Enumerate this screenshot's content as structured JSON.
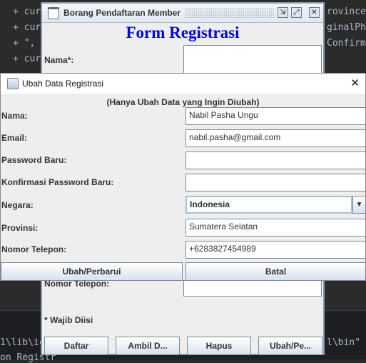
{
  "editor": {
    "lines_left": [
      "+ cur",
      "+ cur",
      "+ \",",
      "+ cur"
    ],
    "lines_right": [
      "rovince",
      "ginalPho",
      "ConfirmP"
    ],
    "terminal_left": "1\\lib\\ic",
    "terminal_right": "l\\bin\" -",
    "terminal_bottom": "on Registr"
  },
  "main_window": {
    "title": "Borang Pendaftaran Member",
    "heading": "Form Registrasi",
    "nama_label": "Nama*:",
    "phone_label": "Nomor Telepon:",
    "required_note": "* Wajib Diisi",
    "buttons": [
      "Daftar",
      "Ambil D...",
      "Hapus",
      "Ubah/Pe..."
    ],
    "controls": {
      "minimize": "⇲",
      "maximize": "⤢",
      "close": "✕"
    }
  },
  "dialog": {
    "title": "Ubah Data Registrasi",
    "close": "✕",
    "subtitle": "(Hanya Ubah Data yang Ingin Diubah)",
    "fields": [
      {
        "label": "Nama:",
        "value": "Nabil Pasha Ungu"
      },
      {
        "label": "Email:",
        "value": "nabil.pasha@gmail.com"
      },
      {
        "label": "Password Baru:",
        "value": ""
      },
      {
        "label": "Konfirmasi Password Baru:",
        "value": ""
      },
      {
        "label": "Negara:",
        "value": "Indonesia"
      },
      {
        "label": "Provinsi:",
        "value": "Sumatera Selatan"
      },
      {
        "label": "Nomor Telepon:",
        "value": "+6283827454989"
      }
    ],
    "update_button": "Ubah/Perbarui",
    "cancel_button": "Batal"
  }
}
